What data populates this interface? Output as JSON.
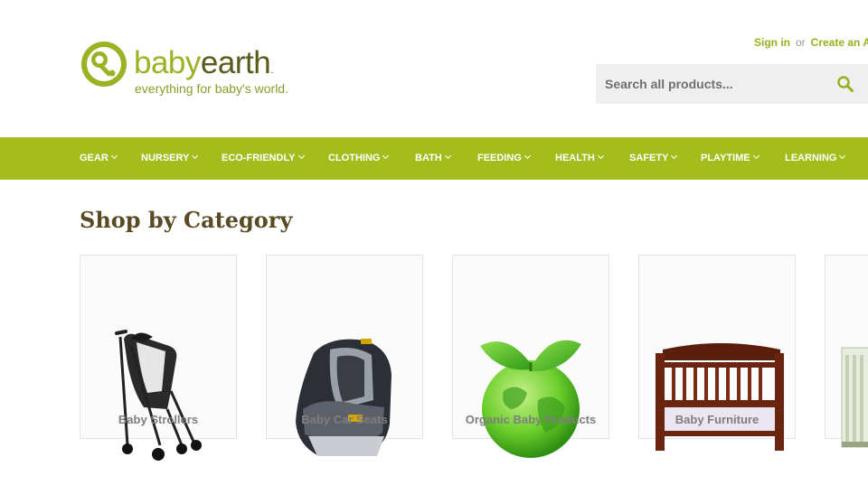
{
  "header": {
    "logo": {
      "baby": "baby",
      "earth": "earth",
      "tagline": "everything for baby's world."
    },
    "account": {
      "sign_in": "Sign in",
      "or": "or",
      "create": "Create an A"
    },
    "search": {
      "placeholder": "Search all products..."
    }
  },
  "nav": {
    "items": [
      {
        "label": "GEAR"
      },
      {
        "label": "NURSERY"
      },
      {
        "label": "ECO-FRIENDLY"
      },
      {
        "label": "CLOTHING"
      },
      {
        "label": "BATH"
      },
      {
        "label": "FEEDING"
      },
      {
        "label": "HEALTH"
      },
      {
        "label": "SAFETY"
      },
      {
        "label": "PLAYTIME"
      },
      {
        "label": "LEARNING"
      }
    ]
  },
  "main": {
    "heading": "Shop by Category",
    "categories": [
      {
        "label": "Baby Strollers",
        "icon": "stroller-image"
      },
      {
        "label": "Baby Car Seats",
        "icon": "car-seat-image"
      },
      {
        "label": "Organic Baby Products",
        "icon": "green-globe-image"
      },
      {
        "label": "Baby Furniture",
        "icon": "crib-image"
      },
      {
        "label": "",
        "icon": "nursery-furniture-image"
      }
    ]
  },
  "colors": {
    "brand_green": "#a4bc1c",
    "dark_olive": "#5a4a24",
    "link_green": "#96b01e"
  }
}
